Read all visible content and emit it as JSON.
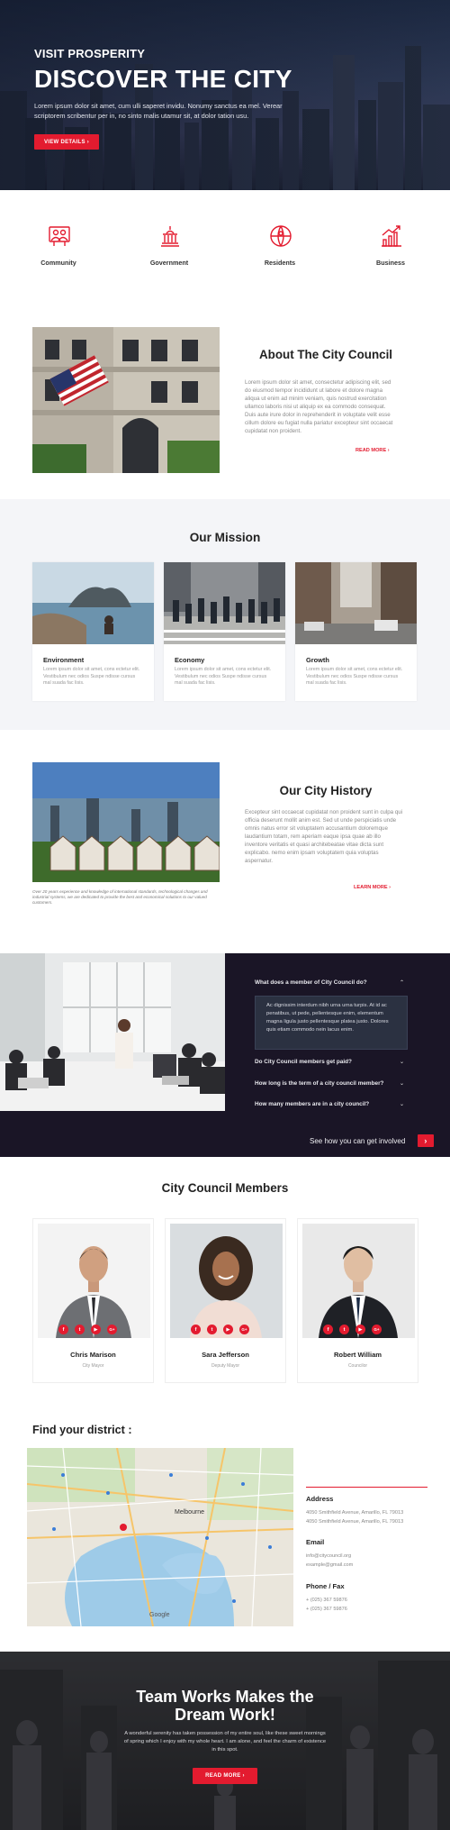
{
  "hero": {
    "kicker": "VISIT PROSPERITY",
    "title": "DISCOVER THE CITY",
    "text_line1": "Lorem ipsum dolor sit amet, cum ulli saperet invidu. Nonumy sanctus ea mel. Verear",
    "text_line2": "scriptorem scribentur per in, no sinto malis utamur sit, at dolor tation usu.",
    "button": "VIEW DETAILS ›"
  },
  "features": [
    {
      "label": "Community",
      "icon": "community-icon"
    },
    {
      "label": "Government",
      "icon": "government-icon"
    },
    {
      "label": "Residents",
      "icon": "residents-icon"
    },
    {
      "label": "Business",
      "icon": "business-icon"
    }
  ],
  "about": {
    "title": "About The City Council",
    "lines": [
      "Lorem ipsum dolor sit amet, consectetur adipiscing elit, sed",
      "do eiusmod tempor incididunt ut labore et dolore magna",
      "aliqua ut enim ad minim veniam, quis nostrud exercitation",
      "ullamco laboris nisi ut aliquip ex ea commodo consequat.",
      "Duis aute irure dolor in reprehenderit in voluptate velit esse",
      "cillum dolore eu fugiat nulla pariatur excepteur sint occaecat",
      "cupidatat non proident."
    ],
    "link": "READ MORE ›"
  },
  "mission": {
    "title": "Our Mission",
    "cards": [
      {
        "title": "Environment",
        "line1": "Lorem ipsum dolor sit amet, cons ectetur elit.",
        "line2": "Vestibulum nec odios Suspe ndisse cursus",
        "line3": "mal suada fac lisis."
      },
      {
        "title": "Economy",
        "line1": "Lorem ipsum dolor sit amet, cons ectetur elit.",
        "line2": "Vestibulum nec odios Suspe ndisse cursus",
        "line3": "mal suada fac lisis."
      },
      {
        "title": "Growth",
        "line1": "Lorem ipsum dolor sit amet, cons ectetur elit.",
        "line2": "Vestibulum nec odios Suspe ndisse cursus",
        "line3": "mal suada fac lisis."
      }
    ]
  },
  "history": {
    "title": "Our City History",
    "lines": [
      "Excepteur sint occaecat cupidatat non proident sunt in culpa qui",
      "officia deserunt mollit anim est. Sed ut unde perspiciatis unde",
      "omnis natus error sit voluptatem accusantium doloremque",
      "laudantium totam, rem aperiam eaque ipsa quae ab illo",
      "inventore veritatis et quasi architebeatae vitae dicta sunt",
      "explicabo. nemo enim ipsam voluptatem quia voluptas",
      "aspernatur."
    ],
    "link": "LEARN MORE ›",
    "caption_line1": "Over 20 years experience and knowledge of international standards, technological changes and",
    "caption_line2": "industrial systems, we are dedicated to provide the best and economical solutions to our valued",
    "caption_line3": "customers."
  },
  "faq": {
    "items": [
      {
        "q": "What does a member of City Council do?",
        "open": true
      },
      {
        "q": "Do City Council members get paid?",
        "open": false
      },
      {
        "q": "How long is the term of a city council member?",
        "open": false
      },
      {
        "q": "How many members are in a city council?",
        "open": false
      }
    ],
    "answer_line1": "Ac dignissim interdum nibh urna urna turpis. At id ac",
    "answer_line2": "penatibus, ut pede, pellentesque enim, elementum",
    "answer_line3": "magna ligula justo pellentesque platea justo. Dolores",
    "answer_line4": "quis etiam commodo nein lacus enim.",
    "cta": "See how you can get involved",
    "cta_button": "›"
  },
  "members": {
    "title": "City Council Members",
    "people": [
      {
        "name": "Chris Marison",
        "role": "City Mayor"
      },
      {
        "name": "Sara Jefferson",
        "role": "Deputy Mayor"
      },
      {
        "name": "Robert William",
        "role": "Councilor"
      }
    ],
    "social": [
      "f",
      "t",
      "▶",
      "G+"
    ]
  },
  "district": {
    "title": "Find your district :",
    "map_city": "Melbourne",
    "map_brand": "Google",
    "address_title": "Address",
    "address_line1": "4050 Smithfield Avenue, Amarillo, FL 79013",
    "address_line2": "4050 Smithfield Avenue, Amarillo, FL 79013",
    "email_title": "Email",
    "email_line1": "info@citycouncil.org",
    "email_line2": "example@gmail.com",
    "phone_title": "Phone / Fax",
    "phone_line1": "+ (025) 367 59876",
    "phone_line2": "+ (025) 367 59876"
  },
  "footer": {
    "title_line1": "Team Works Makes the",
    "title_line2": "Dream Work!",
    "text_line1": "A wonderful serenity has taken possession of my entire soul, like these sweet mornings",
    "text_line2": "of spring which I enjoy with my whole heart. I am alone, and feel the charm of existence",
    "text_line3": "in this spot.",
    "button": "READ MORE ›"
  },
  "colors": {
    "accent": "#e31b2f",
    "dark": "#1a1526",
    "light_bg": "#f4f5f8"
  }
}
